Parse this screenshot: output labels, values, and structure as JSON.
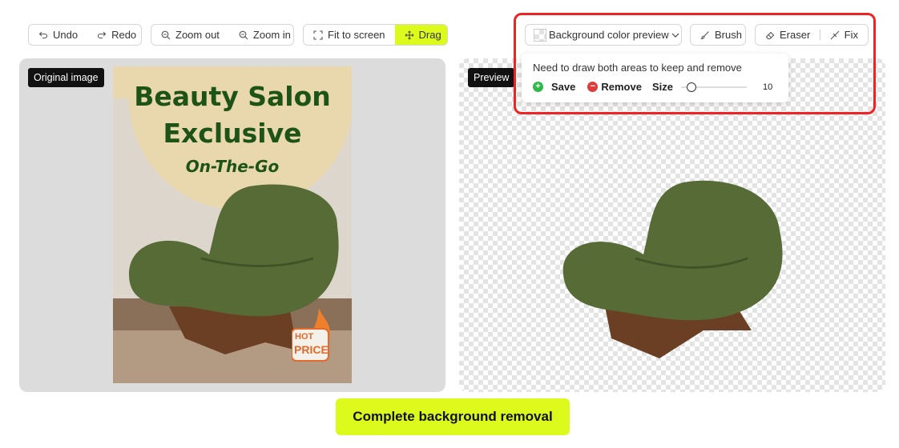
{
  "toolbar": {
    "undo": "Undo",
    "redo": "Redo",
    "zoom_out": "Zoom out",
    "zoom_in": "Zoom in",
    "fit": "Fit to screen",
    "drag": "Drag"
  },
  "right_toolbar": {
    "bg_preview": "Background color preview",
    "brush": "Brush",
    "eraser": "Eraser",
    "fix": "Fix"
  },
  "brush_popover": {
    "hint": "Need to draw both areas to keep and remove",
    "save": "Save",
    "remove": "Remove",
    "size_label": "Size",
    "size_value": "10",
    "size_level": 0.1
  },
  "panels": {
    "original_label": "Original image",
    "preview_label": "Preview"
  },
  "poster": {
    "line1": "Beauty Salon",
    "line2": "Exclusive",
    "line3": "On-The-Go",
    "badge_top": "HOT",
    "badge_bottom": "PRICE"
  },
  "cta": "Complete background removal",
  "colors": {
    "accent": "#dcfb1c",
    "highlight": "#ee2424",
    "save_green": "#2fb84a",
    "remove_red": "#e03b3b",
    "poster_green": "#1e5317"
  }
}
